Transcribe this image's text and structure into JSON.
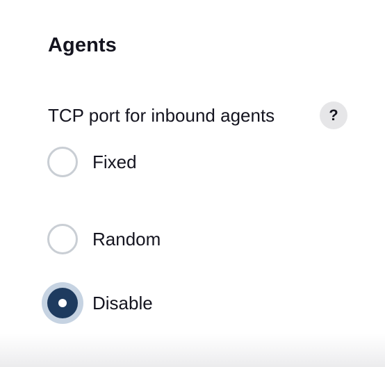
{
  "section": {
    "title": "Agents"
  },
  "tcp_port": {
    "label": "TCP port for inbound agents",
    "help_label": "?",
    "options": [
      {
        "label": "Fixed",
        "selected": false
      },
      {
        "label": "Random",
        "selected": false
      },
      {
        "label": "Disable",
        "selected": true
      }
    ]
  },
  "colors": {
    "radio_selected": "#1e3b5f",
    "radio_selected_ring": "#c6d3e2",
    "radio_unselected_border": "#c9ced4",
    "help_button_bg": "#e6e6e8",
    "text": "#14141f"
  }
}
